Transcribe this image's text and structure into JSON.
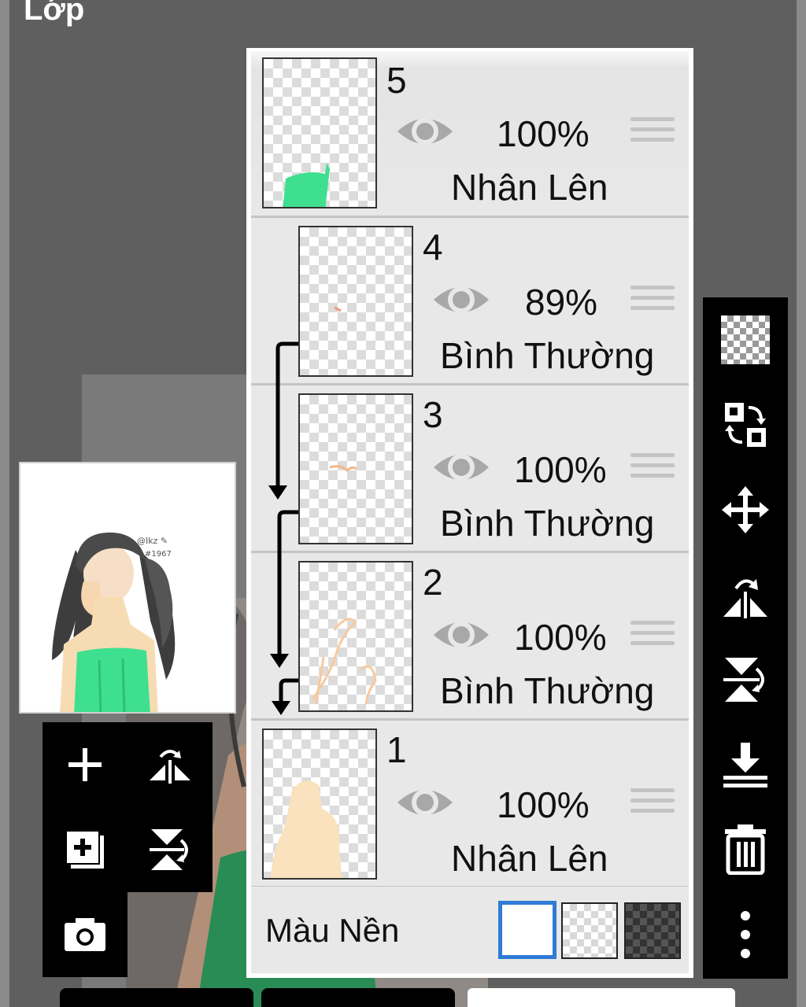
{
  "screen": {
    "title": "Lớp"
  },
  "layers": [
    {
      "number": "5",
      "opacity": "100%",
      "blend_mode": "Nhân Lên",
      "visible": true,
      "clipped": false
    },
    {
      "number": "4",
      "opacity": "89%",
      "blend_mode": "Bình Thường",
      "visible": true,
      "clipped": true
    },
    {
      "number": "3",
      "opacity": "100%",
      "blend_mode": "Bình Thường",
      "visible": true,
      "clipped": true
    },
    {
      "number": "2",
      "opacity": "100%",
      "blend_mode": "Bình Thường",
      "visible": true,
      "clipped": true
    },
    {
      "number": "1",
      "opacity": "100%",
      "blend_mode": "Nhân Lên",
      "visible": true,
      "clipped": false
    }
  ],
  "background": {
    "label": "Màu Nền",
    "options": [
      "white",
      "transparent",
      "dark-checker"
    ],
    "selected": "white"
  },
  "left_tools": [
    "add-layer-icon",
    "flip-horizontal-icon",
    "add-layer-copy-icon",
    "flip-vertical-icon",
    "camera-icon"
  ],
  "right_tools": [
    "transparency-checker-icon",
    "swap-layers-icon",
    "move-icon",
    "flip-horizontal-icon",
    "flip-vertical-icon",
    "merge-down-icon",
    "trash-icon",
    "more-vert-icon"
  ],
  "colors": {
    "accent": "#2f7bd6",
    "panel": "#e8e8e8",
    "toolbar": "#000000",
    "canvas_bg": "#5f5f5f",
    "dress_green": "#3ee08f",
    "skin": "#f7dcb3"
  }
}
